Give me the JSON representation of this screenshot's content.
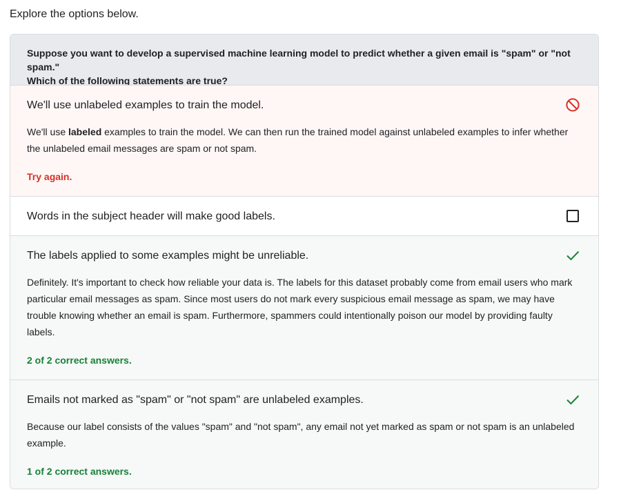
{
  "intro": "Explore the options below.",
  "question": {
    "line1": "Suppose you want to develop a supervised machine learning model to predict whether a given email is \"spam\" or \"not spam.\"",
    "line2": "Which of the following statements are true?"
  },
  "options": [
    {
      "text": "We'll use unlabeled examples to train the model.",
      "status": "incorrect",
      "icon": "block-icon",
      "explanation_pre": "We'll use ",
      "explanation_bold": "labeled",
      "explanation_post": " examples to train the model. We can then run the trained model against unlabeled examples to infer whether the unlabeled email messages are spam or not spam.",
      "feedback": "Try again."
    },
    {
      "text": "Words in the subject header will make good labels.",
      "status": "unselected",
      "icon": "checkbox-empty-icon"
    },
    {
      "text": "The labels applied to some examples might be unreliable.",
      "status": "correct",
      "icon": "checkmark-icon",
      "explanation": "Definitely. It's important to check how reliable your data is. The labels for this dataset probably come from email users who mark particular email messages as spam. Since most users do not mark every suspicious email message as spam, we may have trouble knowing whether an email is spam. Furthermore, spammers could intentionally poison our model by providing faulty labels.",
      "feedback": "2 of 2 correct answers."
    },
    {
      "text": "Emails not marked as \"spam\" or \"not spam\" are unlabeled examples.",
      "status": "correct",
      "icon": "checkmark-icon",
      "explanation": "Because our label consists of the values \"spam\" and \"not spam\", any email not yet marked as spam or not spam is an unlabeled example.",
      "feedback": "1 of 2 correct answers."
    }
  ],
  "colors": {
    "incorrect": "#d93025",
    "correct": "#188038",
    "question_bg": "#e8eaed",
    "wrong_bg": "#fef7f6",
    "right_bg": "#f6f9f8"
  }
}
